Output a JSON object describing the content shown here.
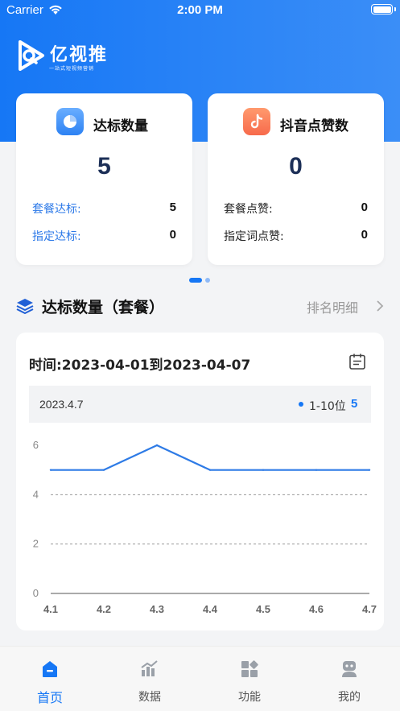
{
  "status_bar": {
    "carrier": "Carrier",
    "time": "2:00 PM"
  },
  "brand": {
    "name": "亿视推",
    "tagline": "一站式短视频营销"
  },
  "cards": [
    {
      "title": "达标数量",
      "icon": "pie-chart-icon",
      "value": "5",
      "rows": [
        {
          "label": "套餐达标:",
          "value": "5"
        },
        {
          "label": "指定达标:",
          "value": "0"
        }
      ]
    },
    {
      "title": "抖音点赞数",
      "icon": "tiktok-icon",
      "value": "0",
      "rows": [
        {
          "label": "套餐点赞:",
          "value": "0"
        },
        {
          "label": "指定词点赞:",
          "value": "0"
        }
      ]
    }
  ],
  "carousel": {
    "pages": 2,
    "active": 0
  },
  "section": {
    "title": "达标数量（套餐）",
    "link": "排名明细"
  },
  "chart_panel": {
    "range_text": "时间:2023-04-01到2023-04-07",
    "tooltip": {
      "date": "2023.4.7",
      "series_name": "1-10位",
      "value": "5"
    }
  },
  "chart_data": {
    "type": "line",
    "x": [
      "4.1",
      "4.2",
      "4.3",
      "4.4",
      "4.5",
      "4.6",
      "4.7"
    ],
    "series": [
      {
        "name": "1-10位",
        "values": [
          5,
          5,
          6,
          5,
          5,
          5,
          5
        ]
      }
    ],
    "yticks": [
      0,
      2,
      4,
      6
    ],
    "ylim": [
      0,
      6
    ],
    "grid": "dashed-horizontal",
    "color": "#2e7be6"
  },
  "tabbar": {
    "items": [
      {
        "label": "首页",
        "icon": "home-icon",
        "active": true
      },
      {
        "label": "数据",
        "icon": "data-chart-icon",
        "active": false
      },
      {
        "label": "功能",
        "icon": "grid-apps-icon",
        "active": false
      },
      {
        "label": "我的",
        "icon": "profile-icon",
        "active": false
      }
    ]
  },
  "colors": {
    "brand_blue": "#1677f5",
    "navy_value": "#1c2f57",
    "background": "#f3f4f6"
  }
}
